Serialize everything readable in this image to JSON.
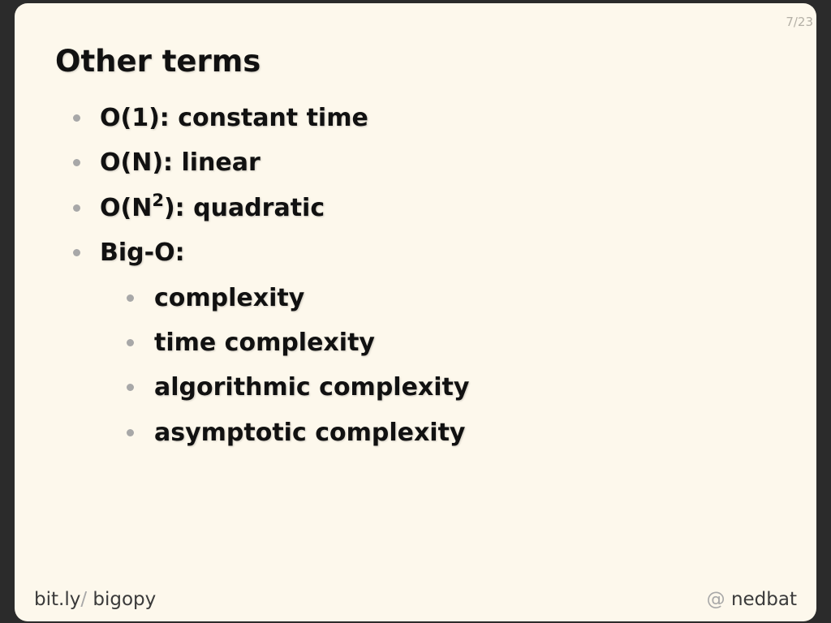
{
  "slide": {
    "page_number": "7/23",
    "title": "Other terms",
    "bullets": [
      {
        "text": "O(1): constant time"
      },
      {
        "text": "O(N): linear"
      },
      {
        "prefix": "O(N",
        "superscript": "2",
        "suffix": "): quadratic"
      },
      {
        "text": "Big-O:"
      }
    ],
    "sub_bullets": [
      "complexity",
      "time complexity",
      "algorithmic complexity",
      "asymptotic complexity"
    ],
    "footer": {
      "left_domain": "bit.ly",
      "left_slash": "/",
      "left_path": " bigopy",
      "right_at": "@",
      "right_handle": " nedbat"
    }
  },
  "colors": {
    "background": "#fdf8ec",
    "frame": "#2b2b2b",
    "text": "#111111",
    "bullet": "#a8a8a8",
    "muted": "#b4b0a6"
  }
}
